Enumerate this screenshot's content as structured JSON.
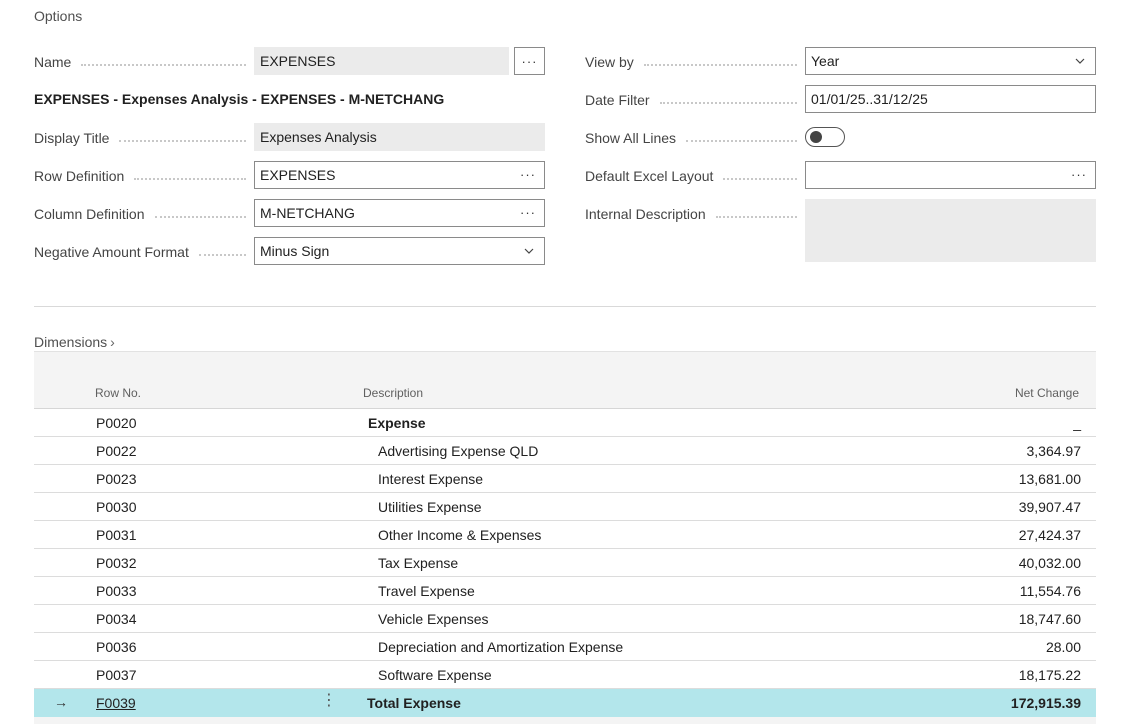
{
  "options": {
    "title": "Options",
    "name": {
      "label": "Name",
      "value": "EXPENSES",
      "lookup": "···"
    },
    "caption": "EXPENSES - Expenses Analysis - EXPENSES - M-NETCHANG",
    "display_title": {
      "label": "Display Title",
      "value": "Expenses Analysis"
    },
    "row_definition": {
      "label": "Row Definition",
      "value": "EXPENSES",
      "assist": "···"
    },
    "column_definition": {
      "label": "Column Definition",
      "value": "M-NETCHANG",
      "assist": "···"
    },
    "negative_amount_format": {
      "label": "Negative Amount Format",
      "value": "Minus Sign"
    },
    "view_by": {
      "label": "View by",
      "value": "Year"
    },
    "date_filter": {
      "label": "Date Filter",
      "value": "01/01/25..31/12/25"
    },
    "show_all_lines": {
      "label": "Show All Lines",
      "value": false
    },
    "default_excel_layout": {
      "label": "Default Excel Layout",
      "value": "",
      "assist": "···"
    },
    "internal_description": {
      "label": "Internal Description",
      "value": ""
    }
  },
  "dimensions": {
    "title": "Dimensions"
  },
  "grid": {
    "headers": {
      "row_no": "Row No.",
      "description": "Description",
      "net_change": "Net Change"
    },
    "rows": [
      {
        "row_no": "P0020",
        "description": "Expense",
        "net_change": "_",
        "heading": true
      },
      {
        "row_no": "P0022",
        "description": "Advertising Expense QLD",
        "net_change": "3,364.97"
      },
      {
        "row_no": "P0023",
        "description": "Interest Expense",
        "net_change": "13,681.00"
      },
      {
        "row_no": "P0030",
        "description": "Utilities Expense",
        "net_change": "39,907.47"
      },
      {
        "row_no": "P0031",
        "description": "Other Income & Expenses",
        "net_change": "27,424.37"
      },
      {
        "row_no": "P0032",
        "description": "Tax Expense",
        "net_change": "40,032.00"
      },
      {
        "row_no": "P0033",
        "description": "Travel Expense",
        "net_change": "11,554.76"
      },
      {
        "row_no": "P0034",
        "description": "Vehicle Expenses",
        "net_change": "18,747.60"
      },
      {
        "row_no": "P0036",
        "description": "Depreciation and Amortization Expense",
        "net_change": "28.00"
      },
      {
        "row_no": "P0037",
        "description": "Software Expense",
        "net_change": "18,175.22"
      }
    ],
    "total": {
      "row_no": "F0039",
      "description": "Total Expense",
      "net_change": "172,915.39",
      "arrow": "→",
      "menu": "⋮"
    }
  },
  "colors": {
    "selected_row": "#b3e6eb",
    "readonly_field": "#ebebeb"
  }
}
